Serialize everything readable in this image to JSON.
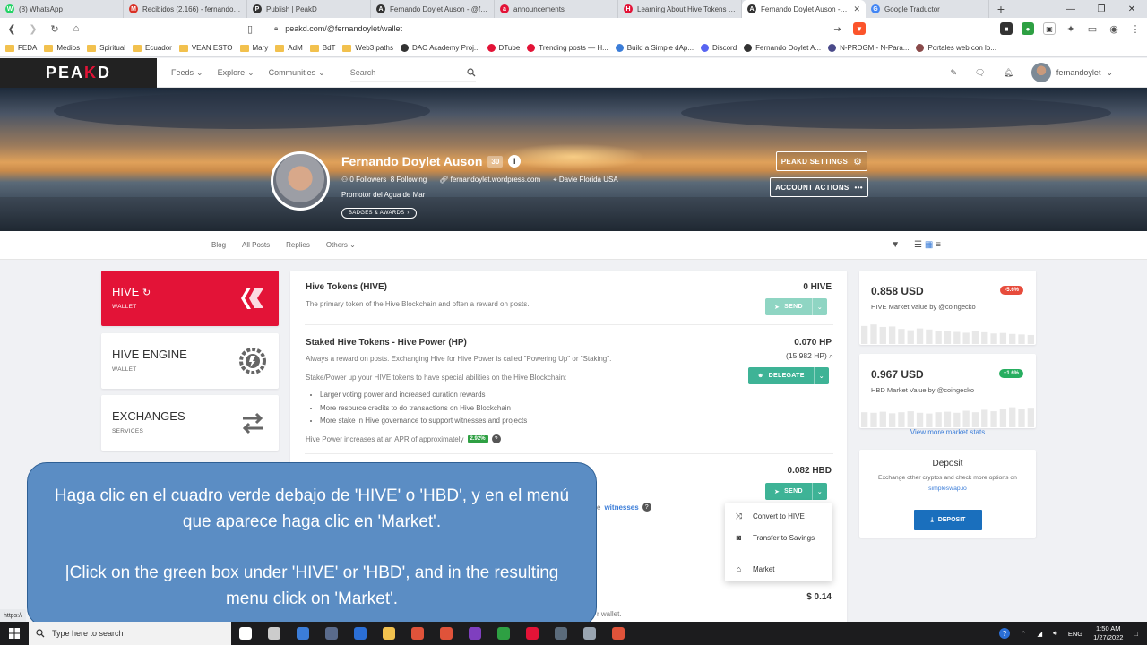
{
  "browser": {
    "tabs": [
      {
        "title": "(8) WhatsApp",
        "color": "#25d366",
        "glyph": "W"
      },
      {
        "title": "Recibidos (2.166) - fernandoylet",
        "color": "#d93025",
        "glyph": "M"
      },
      {
        "title": "Publish | PeakD",
        "color": "#333333",
        "glyph": "P"
      },
      {
        "title": "Fernando Doylet Auson - @ferna",
        "color": "#333333",
        "glyph": "A"
      },
      {
        "title": "announcements",
        "color": "#e31337",
        "glyph": "a"
      },
      {
        "title": "Learning About Hive Tokens and",
        "color": "#e31337",
        "glyph": "H"
      },
      {
        "title": "Fernando Doylet Auson - @",
        "color": "#333333",
        "glyph": "A",
        "active": true
      },
      {
        "title": "Google Traductor",
        "color": "#4285f4",
        "glyph": "G"
      }
    ],
    "url": "peakd.com/@fernandoylet/wallet",
    "bookmarks": [
      {
        "label": "FEDA",
        "kind": "folder"
      },
      {
        "label": "Medios",
        "kind": "folder"
      },
      {
        "label": "Spiritual",
        "kind": "folder"
      },
      {
        "label": "Ecuador",
        "kind": "folder"
      },
      {
        "label": "VEAN ESTO",
        "kind": "folder"
      },
      {
        "label": "Mary",
        "kind": "folder"
      },
      {
        "label": "AdM",
        "kind": "folder"
      },
      {
        "label": "BdT",
        "kind": "folder"
      },
      {
        "label": "Web3 paths",
        "kind": "folder"
      },
      {
        "label": "DAO Academy Proj...",
        "kind": "site",
        "color": "#333333"
      },
      {
        "label": "DTube",
        "kind": "site",
        "color": "#e31337"
      },
      {
        "label": "Trending posts — H...",
        "kind": "site",
        "color": "#e31337"
      },
      {
        "label": "Build a Simple dAp...",
        "kind": "site",
        "color": "#3b7dd8"
      },
      {
        "label": "Discord",
        "kind": "site",
        "color": "#5865f2"
      },
      {
        "label": "Fernando Doylet A...",
        "kind": "site",
        "color": "#333333"
      },
      {
        "label": "N-PRDGM - N-Para...",
        "kind": "site",
        "color": "#4a4a8a"
      },
      {
        "label": "Portales web con lo...",
        "kind": "site",
        "color": "#8a4a4a"
      }
    ]
  },
  "header": {
    "logo_main": "PEA",
    "logo_k": "K",
    "logo_end": "D",
    "nav": [
      {
        "label": "Feeds"
      },
      {
        "label": "Explore"
      },
      {
        "label": "Communities"
      }
    ],
    "search_placeholder": "Search",
    "username": "fernandoylet"
  },
  "profile": {
    "name": "Fernando Doylet Auson",
    "reputation": "30",
    "followers": "0 Followers",
    "following": "8 Following",
    "website": "fernandoylet.wordpress.com",
    "location": "Davie Florida USA",
    "about": "Promotor del Agua de Mar",
    "badges_label": "BADGES & AWARDS",
    "settings_label": "PEAKD SETTINGS",
    "actions_label": "ACCOUNT ACTIONS"
  },
  "subnav": {
    "items": [
      "Blog",
      "All Posts",
      "Replies",
      "Others"
    ]
  },
  "wallet_nav": [
    {
      "title": "HIVE",
      "subtitle": "WALLET"
    },
    {
      "title": "HIVE ENGINE",
      "subtitle": "WALLET"
    },
    {
      "title": "EXCHANGES",
      "subtitle": "SERVICES"
    }
  ],
  "tokens": {
    "hive": {
      "title": "Hive Tokens (HIVE)",
      "desc": "The primary token of the Hive Blockchain and often a reward on posts.",
      "value": "0 HIVE",
      "button": "SEND"
    },
    "hp": {
      "title": "Staked Hive Tokens - Hive Power (HP)",
      "desc": "Always a reward on posts. Exchanging Hive for Hive Power is called \"Powering Up\" or \"Staking\".",
      "value": "0.070 HP",
      "sub_value": "(15.982 HP)",
      "button": "DELEGATE",
      "intro": "Stake/Power up your HIVE tokens to have special abilities on the Hive Blockchain:",
      "bullets": [
        "Larger voting power and increased curation rewards",
        "More resource credits to do transactions on Hive Blockchain",
        "More stake in Hive governance to support witnesses and projects"
      ],
      "apr_text": "Hive Power increases at an APR of approximately",
      "apr_value": "2.92%"
    },
    "hbd": {
      "value": "0.082 HBD",
      "button": "SEND",
      "partial_text": "e",
      "witnesses_link": "witnesses"
    },
    "savings": {
      "value": "$ 0.14",
      "partial_text": "r wallet."
    }
  },
  "dropdown": {
    "items": [
      {
        "label": "Convert to HIVE",
        "icon": "shuffle"
      },
      {
        "label": "Transfer to Savings",
        "icon": "piggy-bank"
      },
      {
        "label": "Market",
        "icon": "store"
      }
    ]
  },
  "market": {
    "hive": {
      "price": "0.858 USD",
      "label": "HIVE Market Value by @coingecko",
      "change": "-5.6%",
      "color": "#e74c3c",
      "bars": [
        0.72,
        0.78,
        0.68,
        0.7,
        0.6,
        0.55,
        0.62,
        0.58,
        0.5,
        0.52,
        0.48,
        0.45,
        0.5,
        0.47,
        0.42,
        0.44,
        0.4,
        0.38,
        0.36
      ]
    },
    "hbd": {
      "price": "0.967 USD",
      "label": "HBD Market Value by @coingecko",
      "change": "+1.6%",
      "color": "#27ae60",
      "bars": [
        0.6,
        0.58,
        0.62,
        0.56,
        0.6,
        0.64,
        0.58,
        0.55,
        0.6,
        0.62,
        0.58,
        0.66,
        0.6,
        0.7,
        0.64,
        0.72,
        0.8,
        0.74,
        0.78
      ]
    },
    "more_stats": "View more market stats"
  },
  "deposit": {
    "title": "Deposit",
    "desc": "Exchange other cryptos and check more options on",
    "link": "simpleswap.io",
    "button": "DEPOSIT"
  },
  "instruction": {
    "es": "Haga clic en el cuadro verde debajo de 'HIVE' o 'HBD', y en el menú que aparece haga clic en 'Market'.",
    "en": "|Click on the green box under 'HIVE' or 'HBD', and in the resulting menu click on 'Market'."
  },
  "status_url": "https://",
  "taskbar": {
    "search_placeholder": "Type here to search",
    "lang": "ENG",
    "time": "1:50 AM",
    "date": "1/27/2022",
    "apps": [
      {
        "color": "#ffffff"
      },
      {
        "color": "#cccccc"
      },
      {
        "color": "#3b7dd8"
      },
      {
        "color": "#5a6b8c"
      },
      {
        "color": "#2b6fd6"
      },
      {
        "color": "#f2c14e"
      },
      {
        "color": "#e0533a"
      },
      {
        "color": "#e0533a"
      },
      {
        "color": "#7f3fbf"
      },
      {
        "color": "#2ea043"
      },
      {
        "color": "#e31337"
      },
      {
        "color": "#5b6b7b"
      },
      {
        "color": "#9aa5b1"
      },
      {
        "color": "#e0533a"
      }
    ]
  },
  "colors": {
    "hive_red": "#e31337",
    "green": "#3eb396",
    "instruction_blue": "#5b8dc4"
  }
}
